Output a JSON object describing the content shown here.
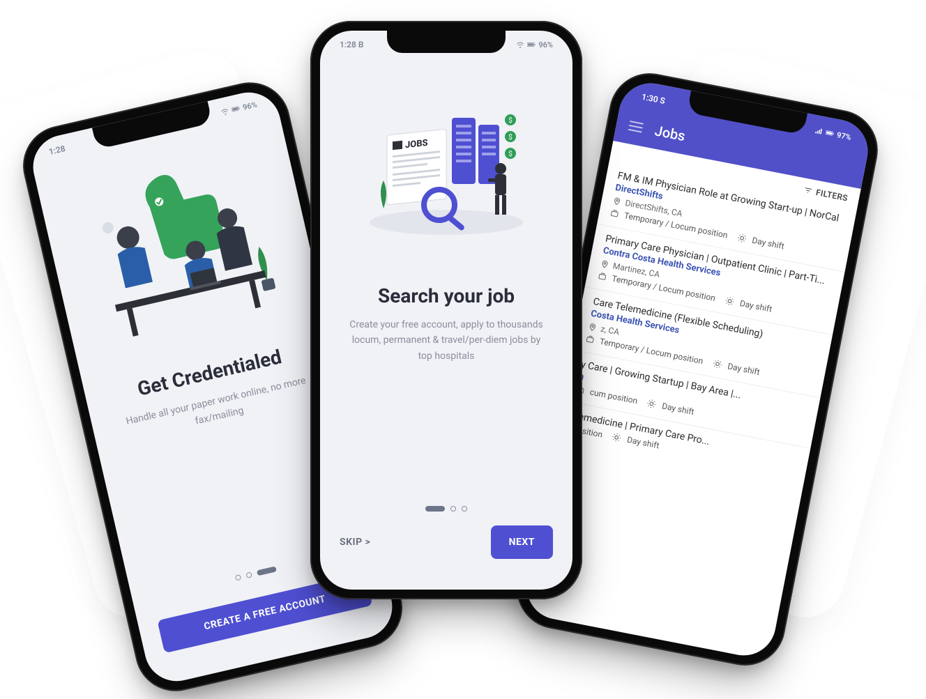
{
  "left": {
    "status_time": "1:28",
    "status_right": "96%",
    "title": "Get Credentialed",
    "desc": "Handle all your paper work online, no more fax/mailing",
    "cta": "CREATE A FREE ACCOUNT",
    "dot_active_index": 2,
    "dot_count": 3
  },
  "center": {
    "status_time": "1:28  B",
    "status_right": "96%",
    "illus_label": "JOBS",
    "title": "Search your job",
    "desc": "Create your free account, apply to thousands locum, permanent & travel/per-diem jobs by top hospitals",
    "skip_label": "SKIP >",
    "next_label": "NEXT",
    "dot_active_index": 0,
    "dot_count": 3
  },
  "right": {
    "status_time": "1:30  S",
    "status_right": "97%",
    "appbar_title": "Jobs",
    "filters_label": "FILTERS",
    "jobs": [
      {
        "title": "FM & IM Physician Role at Growing Start-up | NorCal",
        "company": "DirectShifts",
        "location": "DirectShifts, CA",
        "position": "Temporary / Locum position",
        "shift": "Day shift"
      },
      {
        "title": "Primary Care Physician | Outpatient Clinic | Part-Ti...",
        "company": "Contra Costa Health Services",
        "location": "Martinez, CA",
        "position": "Temporary / Locum position",
        "shift": "Day shift"
      },
      {
        "title": "Care Telemedicine (Flexible Scheduling)",
        "company": "Costa Health Services",
        "location": "z, CA",
        "position": "Temporary / Locum position",
        "shift": "Day shift"
      },
      {
        "title": "y Care | Growing Startup | Bay Area |...",
        "company": "h",
        "location": "",
        "position": "cum position",
        "shift": "Day shift"
      },
      {
        "title": "elemedicine | Primary Care Pro...",
        "company": "",
        "location": "",
        "position": "sition",
        "shift": "Day shift"
      }
    ]
  }
}
